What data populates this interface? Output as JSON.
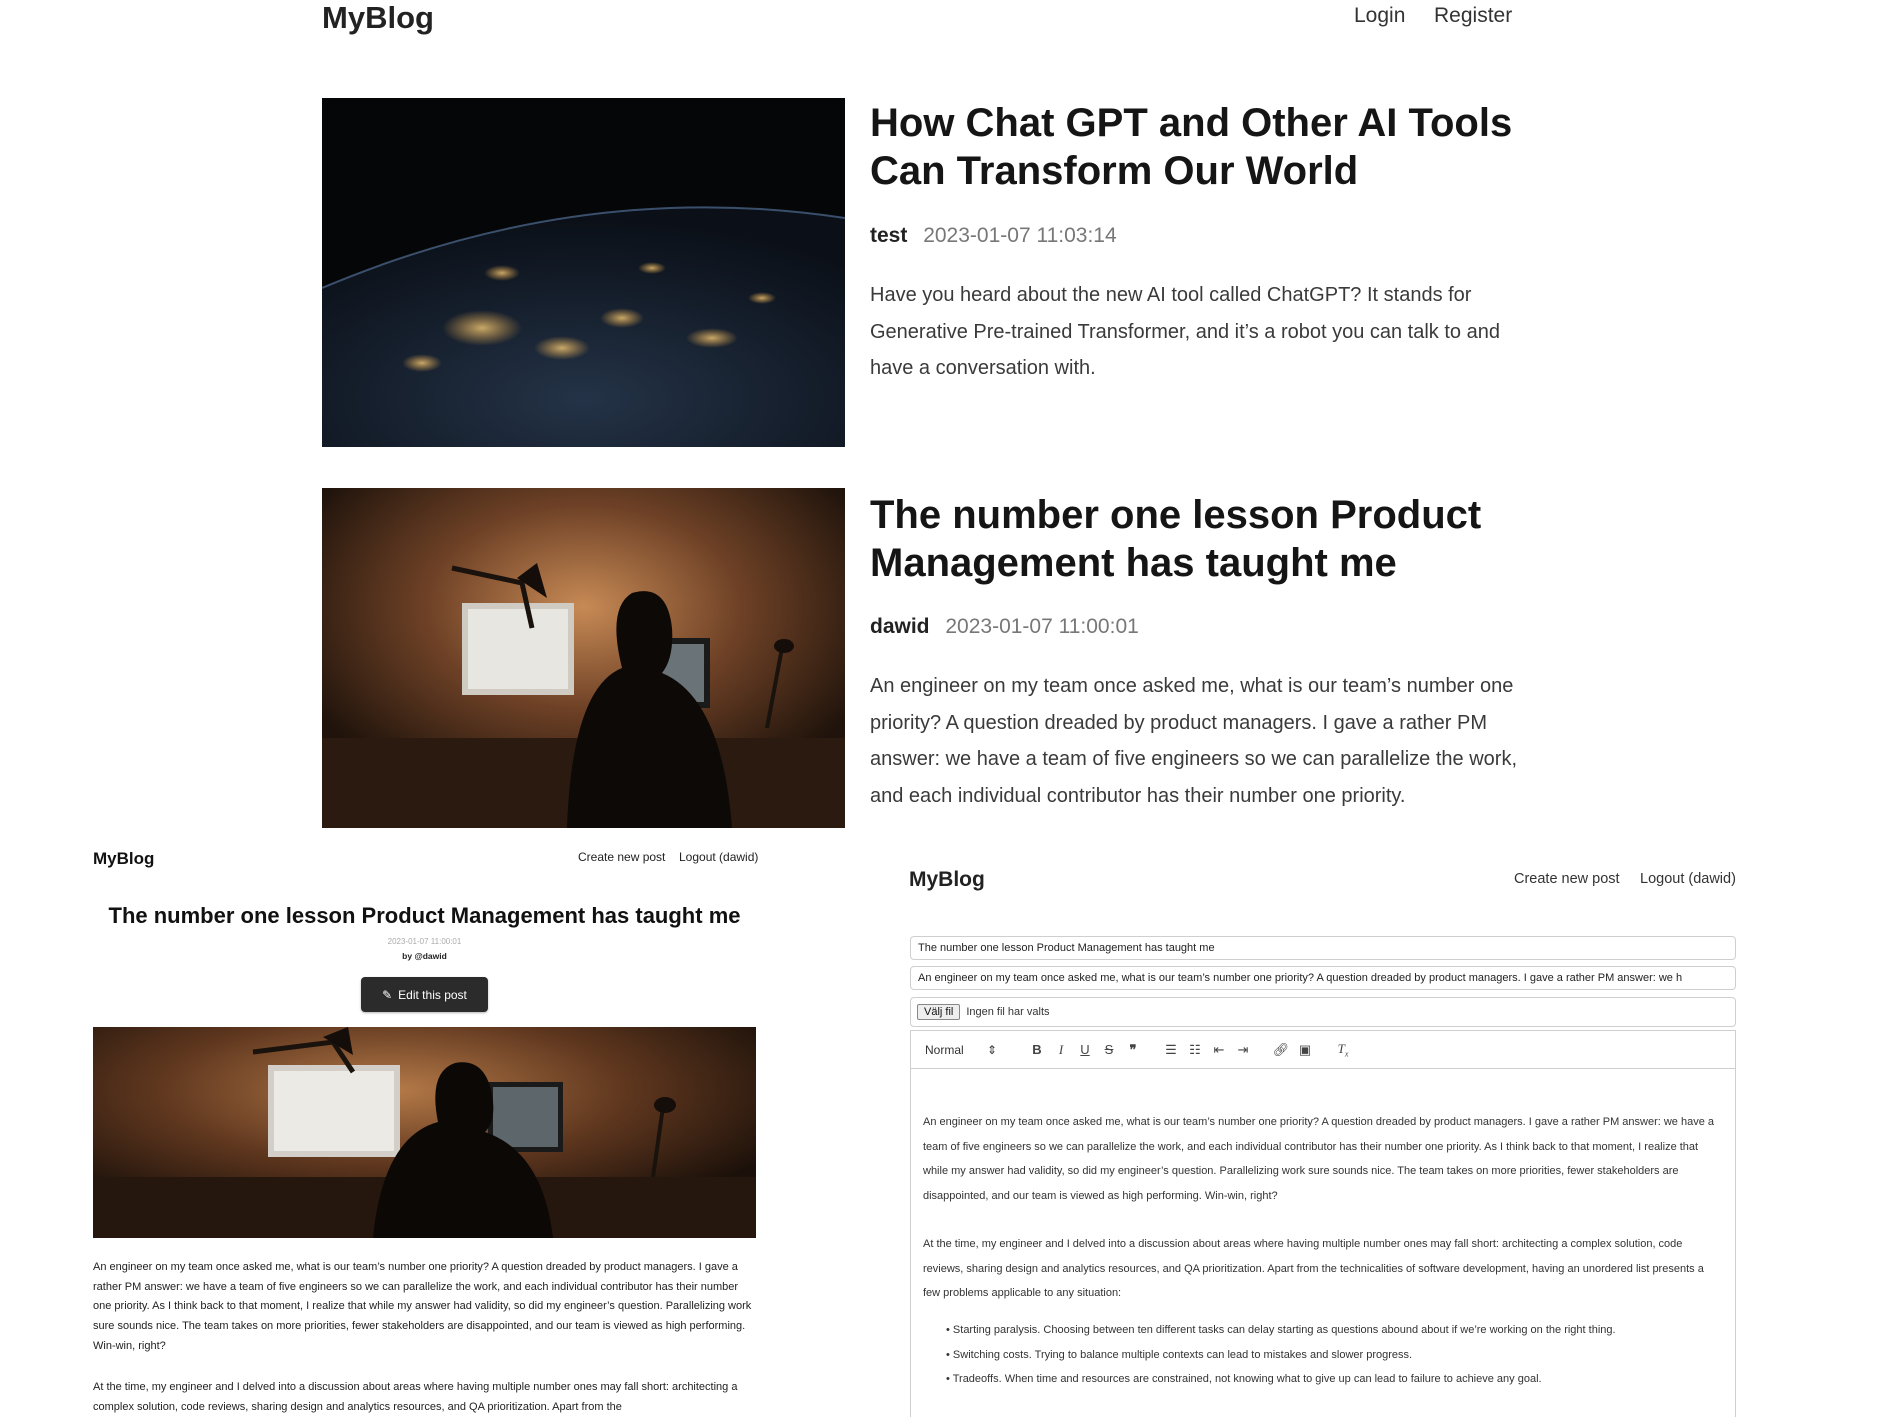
{
  "top": {
    "logo": "MyBlog",
    "nav": {
      "login": "Login",
      "register": "Register"
    },
    "posts": [
      {
        "title": "How Chat GPT and Other AI Tools Can Transform Our World",
        "author": "test",
        "date": "2023-01-07 11:03:14",
        "summary": "Have you heard about the new AI tool called ChatGPT? It stands for Generative Pre-trained Transformer, and it’s a robot you can talk to and have a conversation with."
      },
      {
        "title": "The number one lesson Product Management has taught me",
        "author": "dawid",
        "date": "2023-01-07 11:00:01",
        "summary": "An engineer on my team once asked me, what is our team’s number one priority? A question dreaded by product managers. I gave a rather PM answer: we have a team of five engineers so we can parallelize the work, and each individual contributor has their number one priority."
      }
    ]
  },
  "post_view": {
    "logo": "MyBlog",
    "nav": {
      "create": "Create new post",
      "logout": "Logout (dawid)"
    },
    "title": "The number one lesson Product Management has taught me",
    "date": "2023-01-07 11:00:01",
    "byline": "by @dawid",
    "edit_label": "Edit this post",
    "paragraphs": [
      "An engineer on my team once asked me, what is our team’s number one priority? A question dreaded by product managers. I gave a rather PM answer: we have a team of five engineers so we can parallelize the work, and each individual contributor has their number one priority. As I think back to that moment, I realize that while my answer had validity, so did my engineer’s question. Parallelizing work sure sounds nice. The team takes on more priorities, fewer stakeholders are disappointed, and our team is viewed as high performing. Win-win, right?",
      "At the time, my engineer and I delved into a discussion about areas where having multiple number ones may fall short: architecting a complex solution, code reviews, sharing design and analytics resources, and QA prioritization. Apart from the"
    ]
  },
  "editor": {
    "logo": "MyBlog",
    "nav": {
      "create": "Create new post",
      "logout": "Logout (dawid)"
    },
    "title_value": "The number one lesson Product Management has taught me",
    "summary_value": "An engineer on my team once asked me, what is our team’s number one priority? A question dreaded by product managers. I gave a rather PM answer: we h",
    "file_button": "Välj fil",
    "file_status": "Ingen fil har valts",
    "format_select": "Normal",
    "paragraphs": [
      "An engineer on my team once asked me, what is our team’s number one priority? A question dreaded by product managers. I gave a rather PM answer: we have a team of five engineers so we can parallelize the work, and each individual contributor has their number one priority. As I think back to that moment, I realize that while my answer had validity, so did my engineer’s question. Parallelizing work sure sounds nice. The team takes on more priorities, fewer stakeholders are disappointed, and our team is viewed as high performing. Win-win, right?",
      "At the time, my engineer and I delved into a discussion about areas where having multiple number ones may fall short: architecting a complex solution, code reviews, sharing design and analytics resources, and QA prioritization. Apart from the technicalities of software development, having an unordered list presents a few problems applicable to any situation:"
    ],
    "bullets": [
      "Starting paralysis. Choosing between ten different tasks can delay starting as questions abound about if we’re working on the right thing.",
      "Switching costs. Trying to balance multiple contexts can lead to mistakes and slower progress.",
      "Tradeoffs. When time and resources are constrained, not knowing what to give up can lead to failure to achieve any goal."
    ]
  }
}
